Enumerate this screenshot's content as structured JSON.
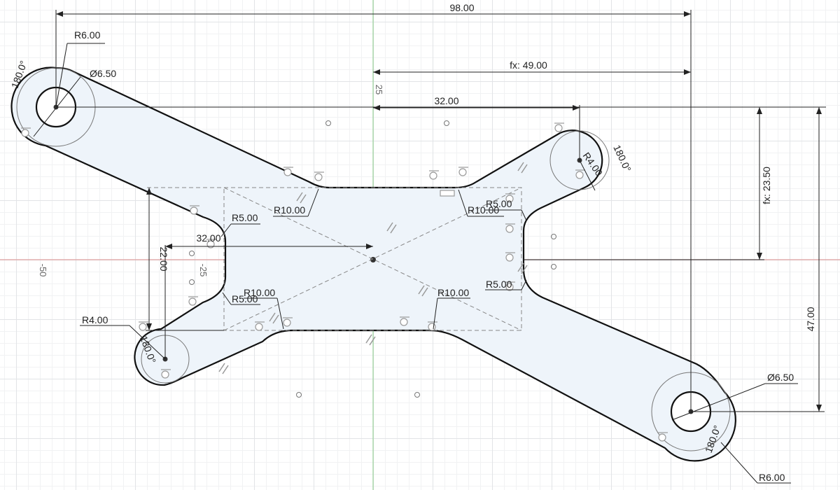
{
  "dimensions": {
    "overall_width": "98.00",
    "half_width": "fx: 49.00",
    "pin_offset_x": "32.00",
    "half_height": "fx: 23.50",
    "overall_height": "47.00",
    "left_arm_offset": "32.00",
    "left_arm_height": "22.00",
    "radius_6_top": "R6.00",
    "radius_6_bottom": "R6.00",
    "dia_top": "Ø6.50",
    "dia_bottom": "Ø6.50",
    "radius_4_left": "R4.00",
    "radius_4_right": "R4.00",
    "angle_top_left": "180.0°",
    "angle_right": "180.0°",
    "angle_bottom_left": "180.0°",
    "angle_bottom_right": "180.0°",
    "r10_top_left": "R10.00",
    "r10_top_right": "R10.00",
    "r10_bottom_left": "R10.00",
    "r10_bottom_right": "R10.00",
    "r5_top_left": "R5.00",
    "r5_top_right": "R5.00",
    "r5_bottom_left": "R5.00",
    "r5_bottom_right": "R5.00"
  },
  "axes": {
    "y_axis_label": "25",
    "x_neg_label": "-50",
    "x_neg25_label": "-25"
  },
  "colors": {
    "profile_fill": "#eef4fa",
    "x_axis": "#e0a0a0",
    "y_axis": "#9ad29a"
  }
}
